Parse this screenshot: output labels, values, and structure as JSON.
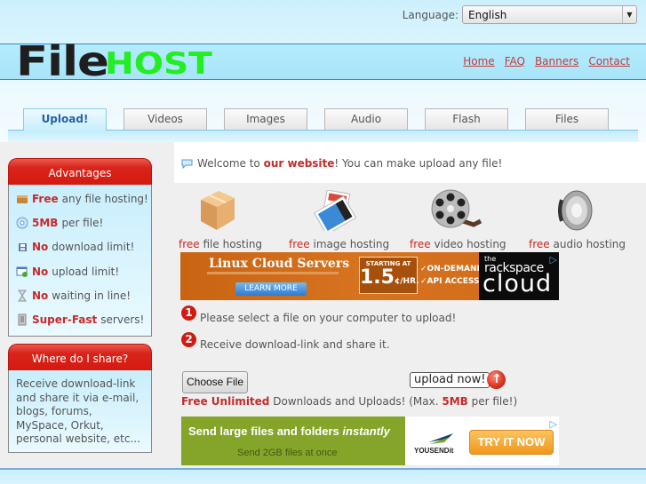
{
  "header": {
    "language_label": "Language:",
    "language_selected": "English",
    "logo_part1": "File",
    "logo_part2": "HOST",
    "nav": [
      "Home",
      "FAQ",
      "Banners",
      "Contact"
    ]
  },
  "tabs": [
    {
      "label": "Upload!",
      "active": true
    },
    {
      "label": "Videos",
      "active": false
    },
    {
      "label": "Images",
      "active": false
    },
    {
      "label": "Audio",
      "active": false
    },
    {
      "label": "Flash",
      "active": false
    },
    {
      "label": "Files",
      "active": false
    }
  ],
  "sidebar": {
    "advantages": {
      "title": "Advantages",
      "items": [
        {
          "icon": "box-icon",
          "highlight": "Free",
          "text": "any file hosting!"
        },
        {
          "icon": "disc-icon",
          "highlight": "5MB",
          "text": "per file!"
        },
        {
          "icon": "floppy-icon",
          "highlight": "No",
          "text": "download limit!"
        },
        {
          "icon": "upload-window-icon",
          "highlight": "No",
          "text": "upload limit!"
        },
        {
          "icon": "hourglass-icon",
          "highlight": "No",
          "text": "waiting in line!"
        },
        {
          "icon": "server-icon",
          "highlight": "Super-Fast",
          "text": "servers!"
        }
      ]
    },
    "share": {
      "title": "Where do I share?",
      "text": "Receive download-link and share it via e-mail, blogs, forums, MySpace, Orkut, personal website, etc..."
    }
  },
  "main": {
    "welcome_prefix": "Welcome to ",
    "welcome_highlight": "our website",
    "welcome_suffix": "! You can make upload any file!",
    "features": [
      {
        "icon": "cardboard-box-icon",
        "free": "free",
        "label": "file hosting"
      },
      {
        "icon": "photos-icon",
        "free": "free",
        "label": "image hosting"
      },
      {
        "icon": "film-reel-icon",
        "free": "free",
        "label": "video hosting"
      },
      {
        "icon": "speaker-icon",
        "free": "free",
        "label": "audio hosting"
      }
    ],
    "steps": [
      {
        "num": "1",
        "text": "Please select a file on your computer to upload!"
      },
      {
        "num": "2",
        "text": "Receive download-link and share it."
      }
    ],
    "choose_file_label": "Choose File",
    "upload_now_label": "upload now!",
    "limit_line": {
      "highlight1": "Free Unlimited",
      "middle": " Downloads and Uploads! (Max. ",
      "highlight2": "5MB",
      "end": " per file!)"
    }
  },
  "ads": {
    "rackspace": {
      "title": "Linux Cloud Servers",
      "button": "LEARN MORE",
      "starting": "STARTING AT",
      "price": "1.5",
      "unit": "¢/HR.",
      "checks": [
        "✓ON-DEMAND",
        "✓API ACCESS"
      ],
      "brand_the": "the",
      "brand_name": "rackspace",
      "brand_cloud": "cloud"
    },
    "yousendit": {
      "headline": "Send large files and folders ",
      "headline_em": "instantly",
      "sub": "Send 2GB files at once",
      "brand": "YOUSENDit",
      "button": "TRY IT NOW"
    }
  }
}
